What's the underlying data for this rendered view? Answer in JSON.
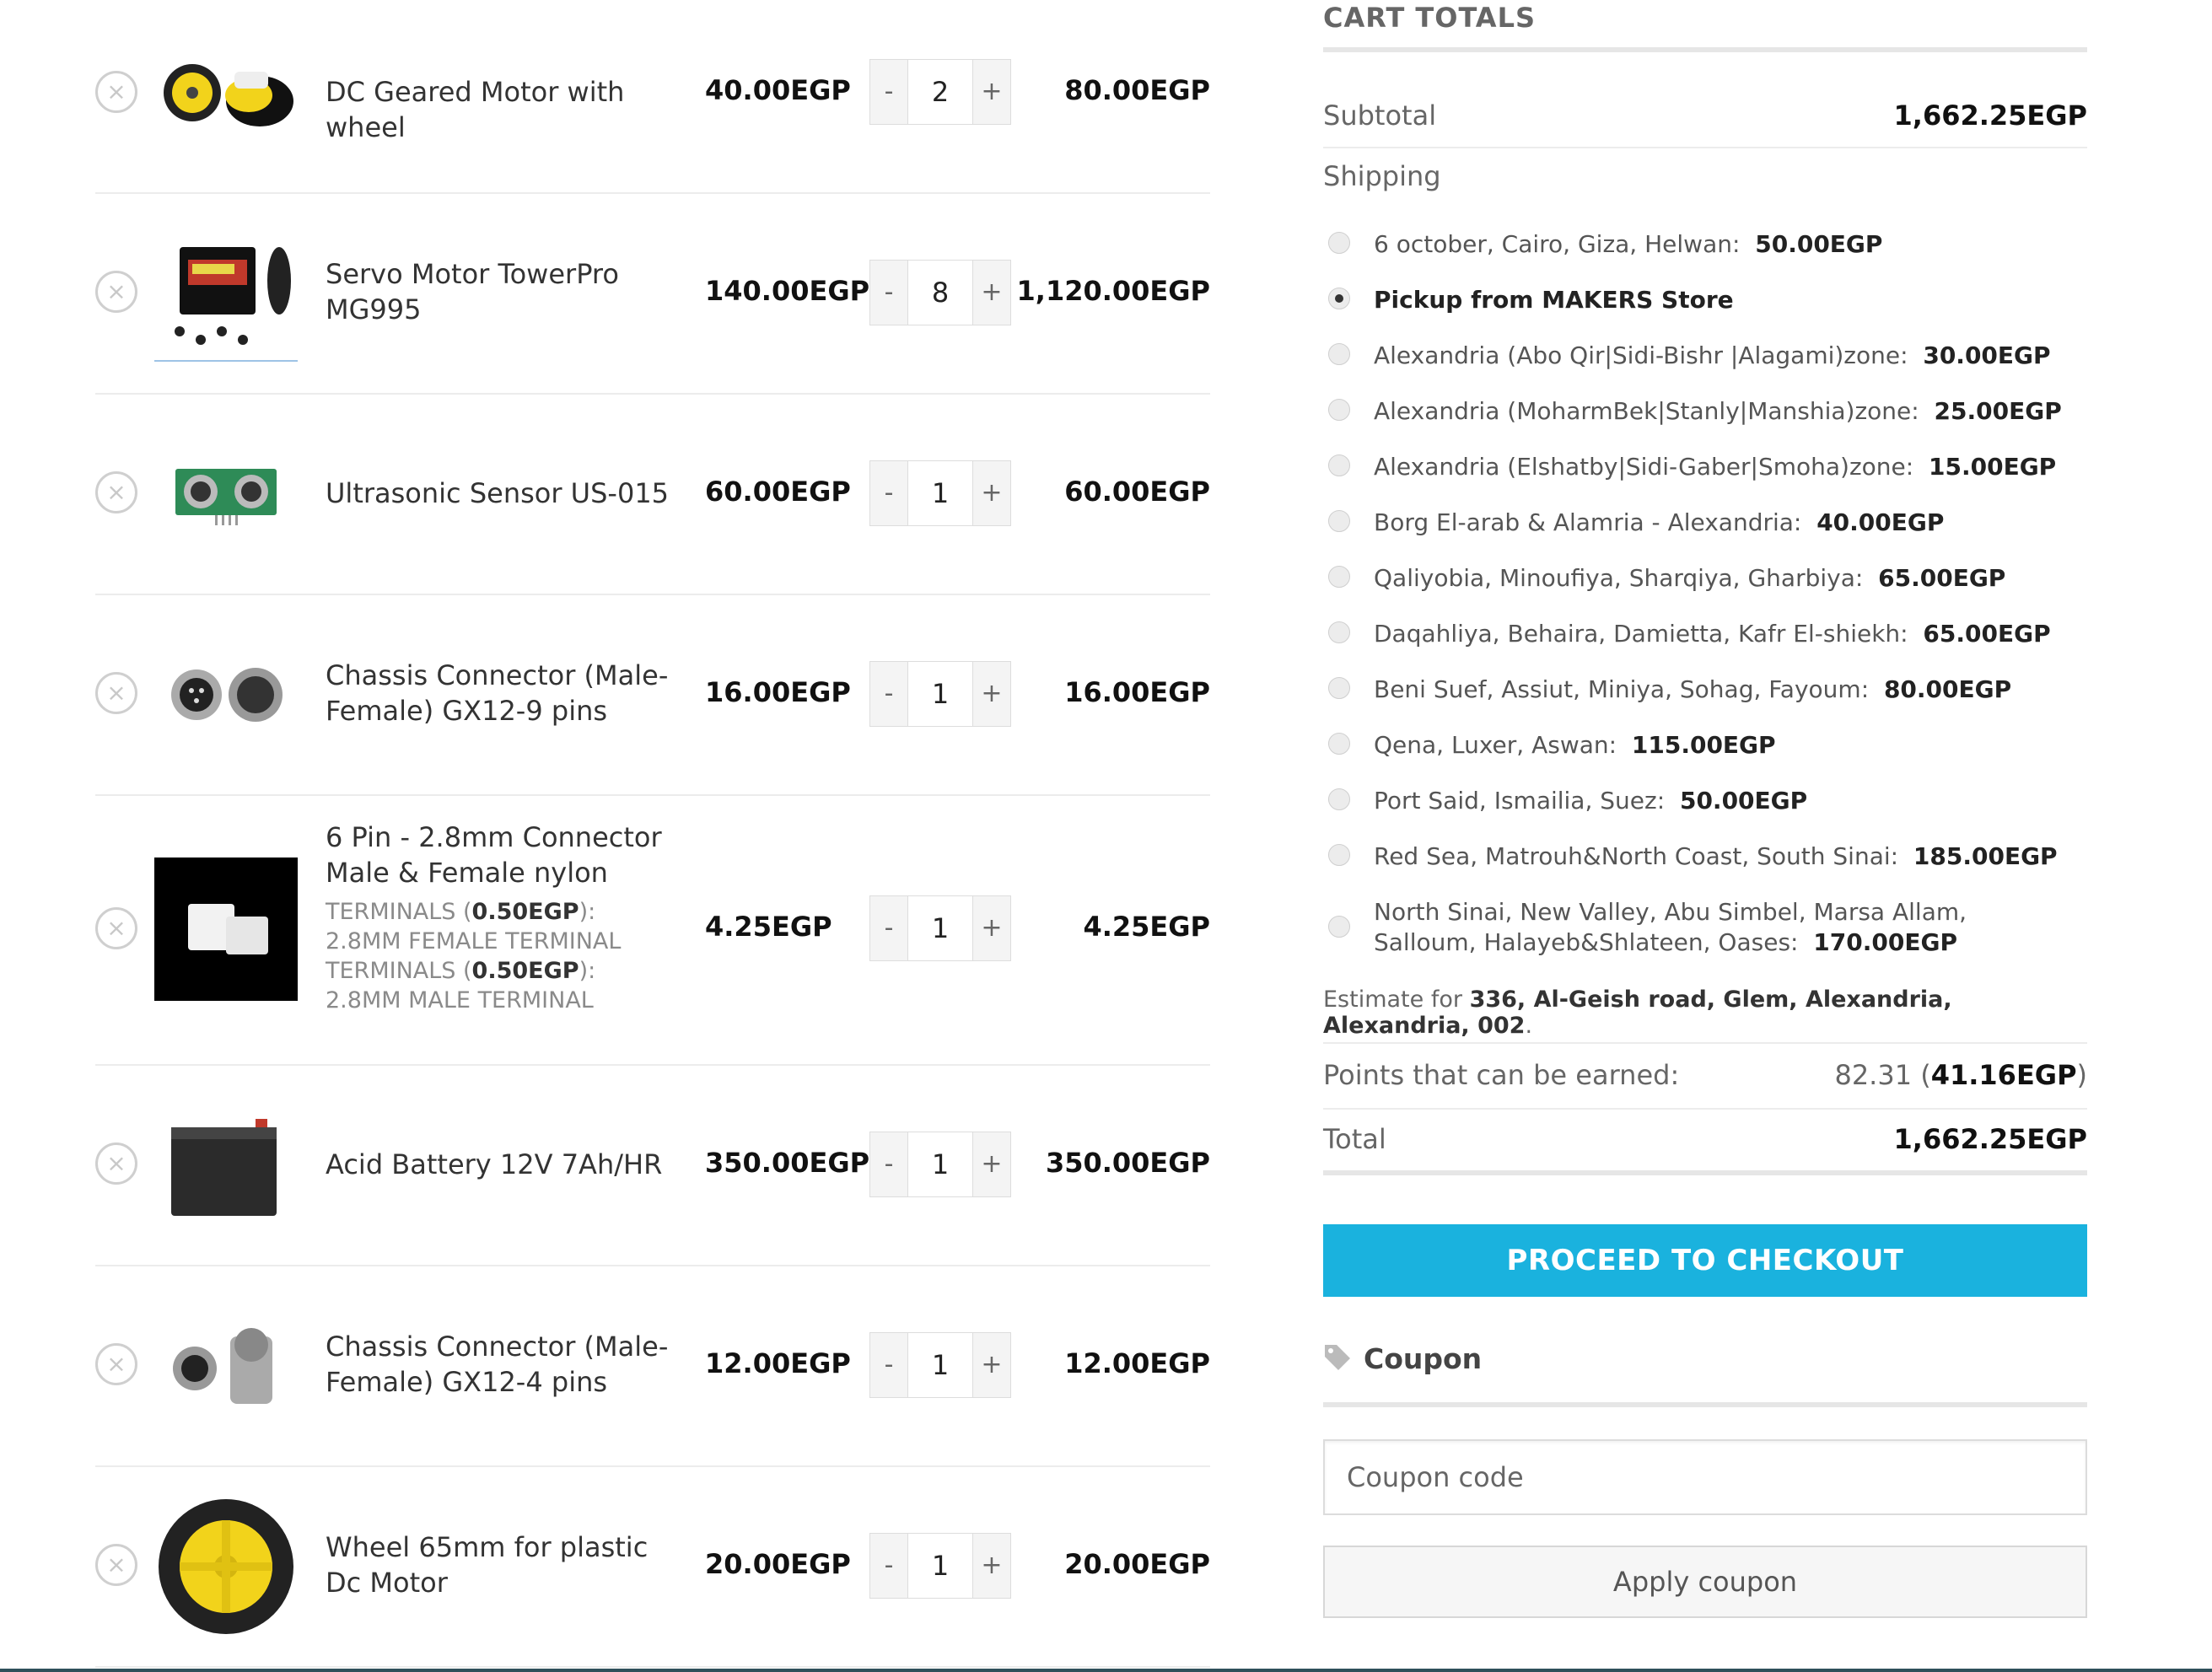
{
  "cart": {
    "items": [
      {
        "name": "DC Geared Motor with wheel",
        "price": "40.00EGP",
        "qty": "2",
        "subtotal": "80.00EGP",
        "image": "yellow-gear-motor"
      },
      {
        "name": "Servo Motor TowerPro MG995",
        "price": "140.00EGP",
        "qty": "8",
        "subtotal": "1,120.00EGP",
        "image": "servo-motor"
      },
      {
        "name": "Ultrasonic Sensor US-015",
        "price": "60.00EGP",
        "qty": "1",
        "subtotal": "60.00EGP",
        "image": "ultrasonic-sensor"
      },
      {
        "name": "Chassis Connector (Male-Female) GX12-9 pins",
        "price": "16.00EGP",
        "qty": "1",
        "subtotal": "16.00EGP",
        "image": "gx12-connector"
      },
      {
        "name": "6 Pin - 2.8mm Connector Male & Female nylon",
        "price": "4.25EGP",
        "qty": "1",
        "subtotal": "4.25EGP",
        "image": "nylon-connector",
        "meta": [
          {
            "label": "TERMINALS",
            "amount": "0.50EGP",
            "value": "2.8MM FEMALE TERMINAL"
          },
          {
            "label": "TERMINALS",
            "amount": "0.50EGP",
            "value": "2.8MM MALE TERMINAL"
          }
        ]
      },
      {
        "name": "Acid Battery 12V 7Ah/HR",
        "price": "350.00EGP",
        "qty": "1",
        "subtotal": "350.00EGP",
        "image": "battery"
      },
      {
        "name": "Chassis Connector (Male-Female) GX12-4 pins",
        "price": "12.00EGP",
        "qty": "1",
        "subtotal": "12.00EGP",
        "image": "gx12-connector"
      },
      {
        "name": "Wheel 65mm for plastic Dc Motor",
        "price": "20.00EGP",
        "qty": "1",
        "subtotal": "20.00EGP",
        "image": "wheel"
      }
    ],
    "remove_symbol": "×",
    "minus_symbol": "-",
    "plus_symbol": "+"
  },
  "totals": {
    "title": "CART TOTALS",
    "subtotal_label": "Subtotal",
    "subtotal_value": "1,662.25EGP",
    "shipping_label": "Shipping",
    "shipping_options": [
      {
        "label": "6 october, Cairo, Giza, Helwan:",
        "price": "50.00EGP",
        "selected": false
      },
      {
        "label": "Pickup from MAKERS Store",
        "price": "",
        "selected": true
      },
      {
        "label": "Alexandria (Abo Qir|Sidi-Bishr |Alagami)zone:",
        "price": "30.00EGP",
        "selected": false
      },
      {
        "label": "Alexandria (MoharmBek|Stanly|Manshia)zone:",
        "price": "25.00EGP",
        "selected": false
      },
      {
        "label": "Alexandria (Elshatby|Sidi-Gaber|Smoha)zone:",
        "price": "15.00EGP",
        "selected": false
      },
      {
        "label": "Borg El-arab & Alamria - Alexandria:",
        "price": "40.00EGP",
        "selected": false
      },
      {
        "label": "Qaliyobia, Minoufiya, Sharqiya, Gharbiya:",
        "price": "65.00EGP",
        "selected": false
      },
      {
        "label": "Daqahliya, Behaira, Damietta, Kafr El-shiekh:",
        "price": "65.00EGP",
        "selected": false
      },
      {
        "label": "Beni Suef, Assiut, Miniya, Sohag, Fayoum:",
        "price": "80.00EGP",
        "selected": false
      },
      {
        "label": "Qena, Luxer, Aswan:",
        "price": "115.00EGP",
        "selected": false
      },
      {
        "label": "Port Said, Ismailia, Suez:",
        "price": "50.00EGP",
        "selected": false
      },
      {
        "label": "Red Sea, Matrouh&North Coast, South Sinai:",
        "price": "185.00EGP",
        "selected": false
      },
      {
        "label": "North Sinai, New Valley, Abu Simbel, Marsa Allam, Salloum, Halayeb&Shlateen, Oases:",
        "price": "170.00EGP",
        "selected": false
      }
    ],
    "estimate_prefix": "Estimate for",
    "estimate_address": "336, Al-Geish road, Glem, Alexandria, Alexandria, 002",
    "estimate_suffix": ".",
    "points_label": "Points that can be earned:",
    "points_value": "82.31",
    "points_money": "41.16EGP",
    "total_label": "Total",
    "total_value": "1,662.25EGP",
    "checkout_label": "PROCEED TO CHECKOUT",
    "checkout_color": "#1ab2de"
  },
  "coupon": {
    "heading": "Coupon",
    "icon": "tag-icon",
    "placeholder": "Coupon code",
    "apply_label": "Apply coupon"
  }
}
